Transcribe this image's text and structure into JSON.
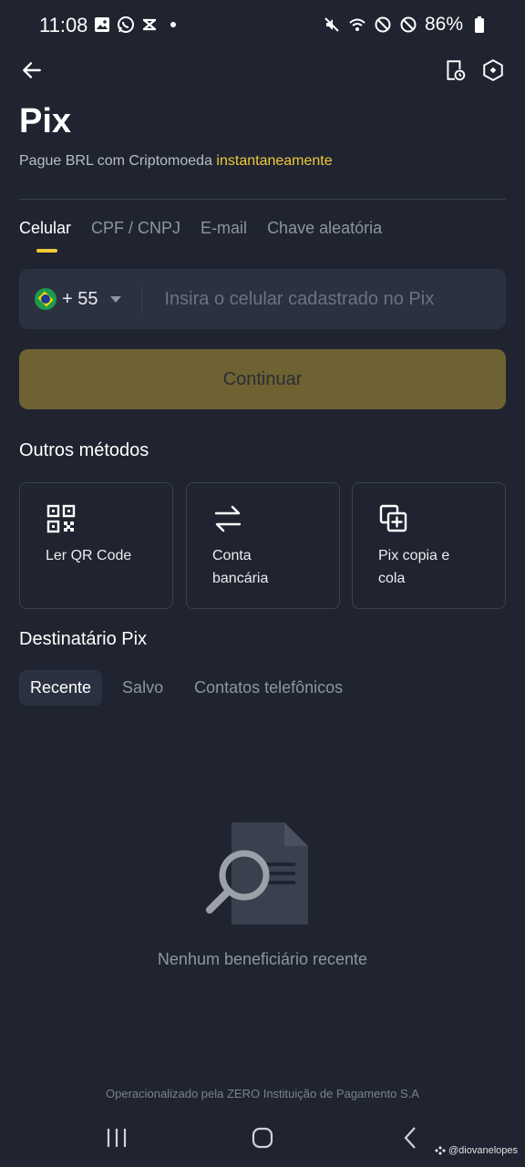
{
  "status_bar": {
    "time": "11:08",
    "battery": "86%"
  },
  "header": {
    "title": "Pix",
    "subtitle_prefix": "Pague BRL com Criptomoeda",
    "subtitle_highlight": "instantaneamente"
  },
  "tabs": [
    {
      "label": "Celular",
      "active": true
    },
    {
      "label": "CPF / CNPJ",
      "active": false
    },
    {
      "label": "E-mail",
      "active": false
    },
    {
      "label": "Chave aleatória",
      "active": false
    }
  ],
  "phone": {
    "country_code": "+ 55",
    "value": "",
    "placeholder": "Insira o celular cadastrado no Pix"
  },
  "continue_label": "Continuar",
  "other_methods": {
    "title": "Outros métodos",
    "items": [
      {
        "label": "Ler QR Code",
        "icon": "qr-code-icon"
      },
      {
        "label": "Conta bancária",
        "icon": "transfer-arrows-icon"
      },
      {
        "label": "Pix copia e cola",
        "icon": "copy-paste-icon"
      }
    ]
  },
  "recipient": {
    "title": "Destinatário Pix",
    "tabs": [
      {
        "label": "Recente",
        "active": true
      },
      {
        "label": "Salvo",
        "active": false
      },
      {
        "label": "Contatos telefônicos",
        "active": false
      }
    ],
    "empty_text": "Nenhum beneficiário recente"
  },
  "footer_note": "Operacionalizado pela ZERO Instituição de Pagamento S.A",
  "watermark": "@diovanelopes",
  "colors": {
    "background": "#1f2430",
    "accent": "#f0c93a",
    "button_disabled": "#6f6232",
    "surface": "#2b3140"
  }
}
